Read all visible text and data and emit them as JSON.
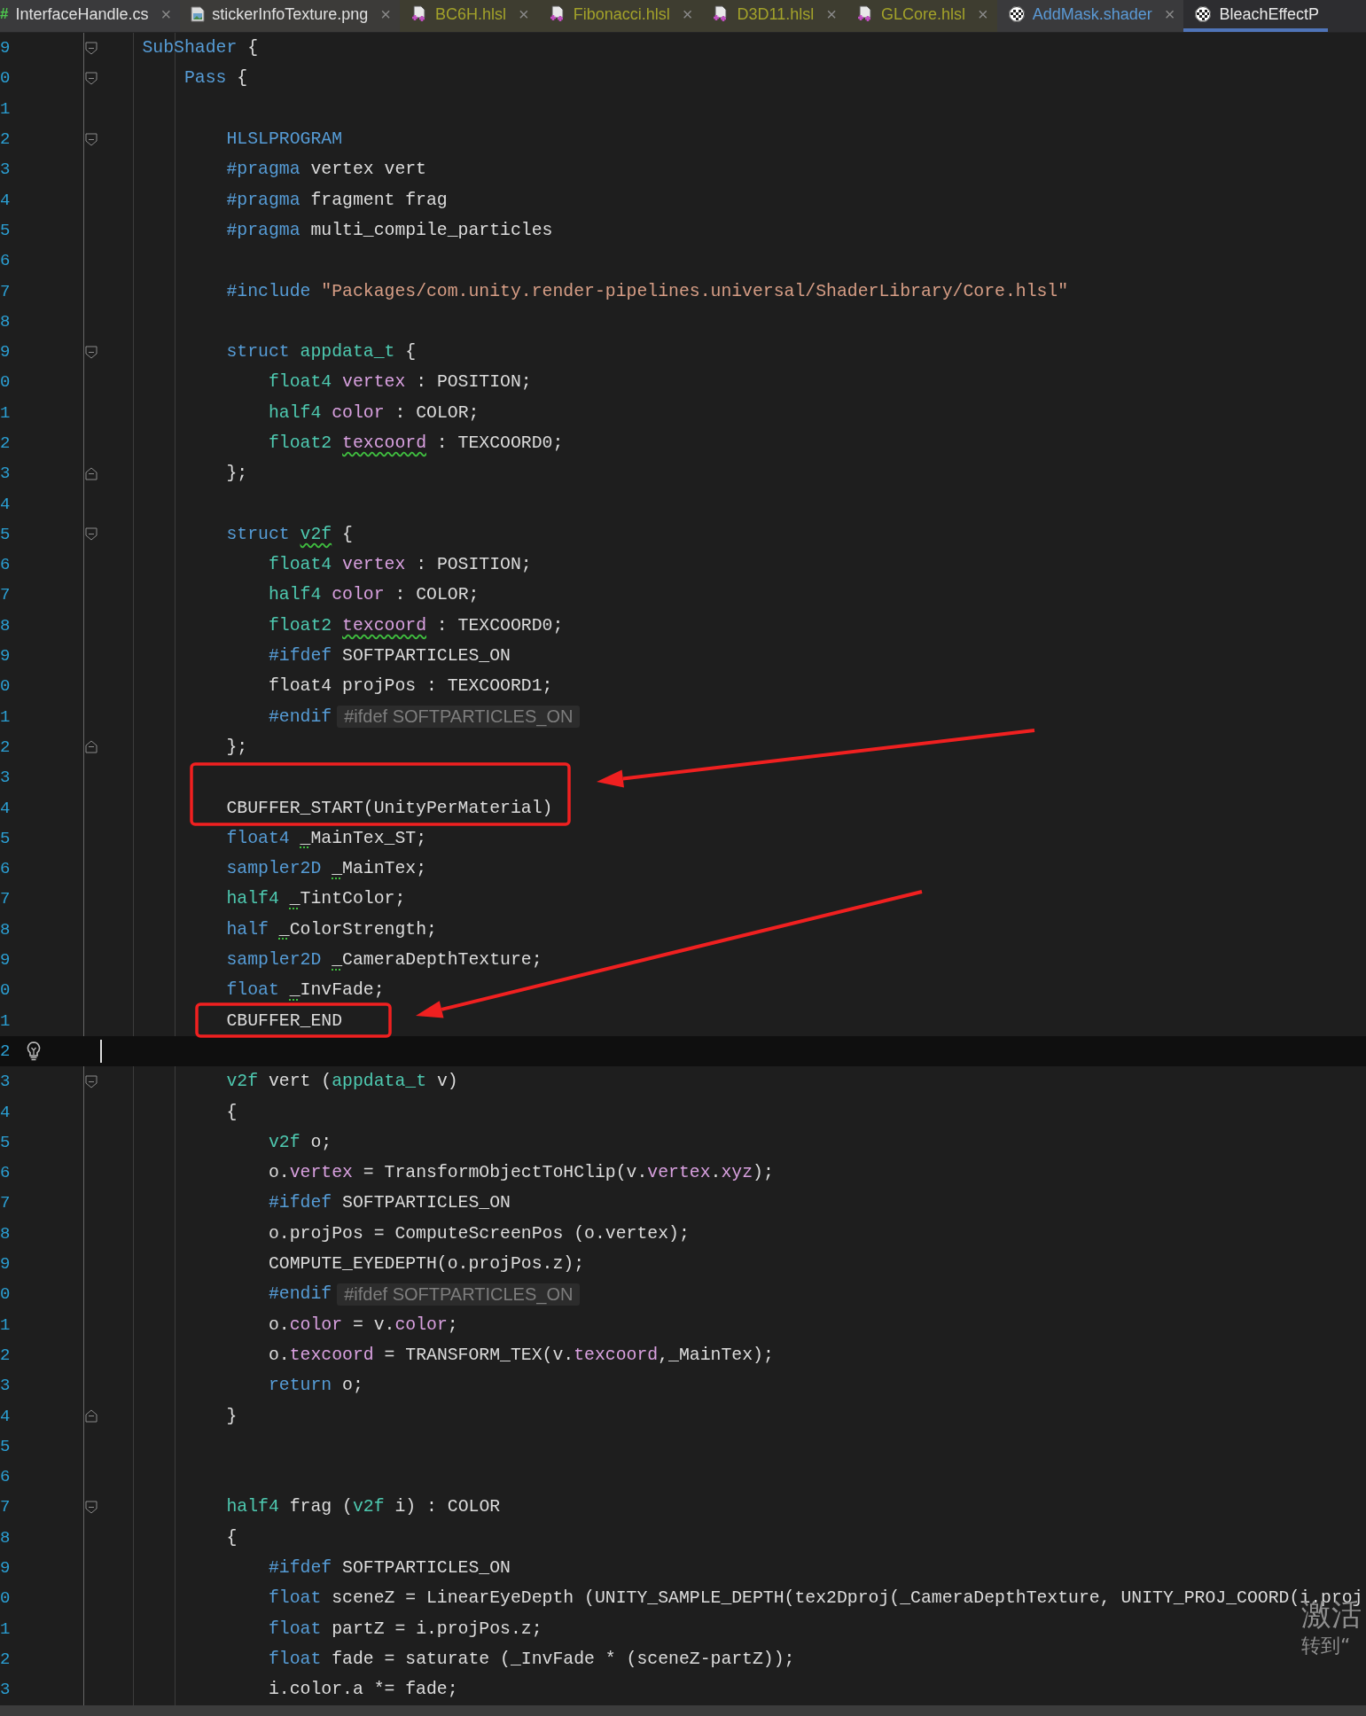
{
  "tabs": [
    {
      "glyph": "#",
      "label": "InterfaceHandle.cs",
      "kind": "cs",
      "close": "×",
      "selected": false
    },
    {
      "label": "stickerInfoTexture.png",
      "kind": "image",
      "close": "×",
      "selected": false
    },
    {
      "label": "BC6H.hlsl",
      "kind": "hlsl",
      "close": "×",
      "selected": false
    },
    {
      "label": "Fibonacci.hlsl",
      "kind": "hlsl",
      "close": "×",
      "selected": false
    },
    {
      "label": "D3D11.hlsl",
      "kind": "hlsl",
      "close": "×",
      "selected": false
    },
    {
      "label": "GLCore.hlsl",
      "kind": "hlsl",
      "close": "×",
      "selected": false
    },
    {
      "label": "AddMask.shader",
      "kind": "shader",
      "close": "×",
      "selected": false
    },
    {
      "label": "BleachEffectP",
      "kind": "shader",
      "selected": true
    }
  ],
  "lines": [
    {
      "number": "9",
      "block_start": true,
      "code": [
        {
          "kind": "kw",
          "text": "    SubShader"
        },
        {
          "kind": "plain",
          "text": " {"
        }
      ]
    },
    {
      "number": "0",
      "block_start": true,
      "code": [
        {
          "kind": "kw",
          "text": "        Pass"
        },
        {
          "kind": "plain",
          "text": " {"
        }
      ]
    },
    {
      "number": "1"
    },
    {
      "number": "2",
      "block_start": true,
      "code": [
        {
          "kind": "kw",
          "text": "            HLSLPROGRAM"
        }
      ]
    },
    {
      "number": "3",
      "code": [
        {
          "kind": "kw",
          "text": "            #pragma"
        },
        {
          "kind": "plain",
          "text": " vertex vert"
        }
      ]
    },
    {
      "number": "4",
      "code": [
        {
          "kind": "kw",
          "text": "            #pragma"
        },
        {
          "kind": "plain",
          "text": " fragment frag"
        }
      ]
    },
    {
      "number": "5",
      "code": [
        {
          "kind": "kw",
          "text": "            #pragma"
        },
        {
          "kind": "plain",
          "text": " multi_compile_particles"
        }
      ]
    },
    {
      "number": "6"
    },
    {
      "number": "7",
      "code": [
        {
          "kind": "kw",
          "text": "            #include"
        },
        {
          "kind": "str",
          "text": " \"Packages/com.unity.render-pipelines.universal/ShaderLibrary/Core.hlsl\""
        }
      ]
    },
    {
      "number": "8"
    },
    {
      "number": "9",
      "block_start": true,
      "code": [
        {
          "kind": "kw",
          "text": "            struct"
        },
        {
          "kind": "type",
          "text": " appdata_t"
        },
        {
          "kind": "plain",
          "text": " {"
        }
      ]
    },
    {
      "number": "0",
      "code": [
        {
          "kind": "type",
          "text": "                float4"
        },
        {
          "kind": "field",
          "text": " vertex"
        },
        {
          "kind": "plain",
          "text": " : POSITION;"
        }
      ]
    },
    {
      "number": "1",
      "code": [
        {
          "kind": "type",
          "text": "                half4"
        },
        {
          "kind": "field",
          "text": " color"
        },
        {
          "kind": "plain",
          "text": " : COLOR;"
        }
      ]
    },
    {
      "number": "2",
      "code": [
        {
          "kind": "type",
          "text": "                float2 "
        },
        {
          "kind": "fieldwarn",
          "text": "texcoord"
        },
        {
          "kind": "plain",
          "text": " : TEXCOORD0;"
        }
      ]
    },
    {
      "number": "3",
      "block_end": true,
      "code": [
        {
          "kind": "plain",
          "text": "            };"
        }
      ]
    },
    {
      "number": "4"
    },
    {
      "number": "5",
      "block_start": true,
      "code": [
        {
          "kind": "kw",
          "text": "            struct "
        },
        {
          "kind": "typewarn",
          "text": "v2f"
        },
        {
          "kind": "plain",
          "text": " {"
        }
      ]
    },
    {
      "number": "6",
      "code": [
        {
          "kind": "type",
          "text": "                float4"
        },
        {
          "kind": "field",
          "text": " vertex"
        },
        {
          "kind": "plain",
          "text": " : POSITION;"
        }
      ]
    },
    {
      "number": "7",
      "code": [
        {
          "kind": "type",
          "text": "                half4"
        },
        {
          "kind": "field",
          "text": " color"
        },
        {
          "kind": "plain",
          "text": " : COLOR;"
        }
      ]
    },
    {
      "number": "8",
      "code": [
        {
          "kind": "type",
          "text": "                float2 "
        },
        {
          "kind": "fieldwarn",
          "text": "texcoord"
        },
        {
          "kind": "plain",
          "text": " : TEXCOORD0;"
        }
      ]
    },
    {
      "number": "9",
      "code": [
        {
          "kind": "kw",
          "text": "                #ifdef"
        },
        {
          "kind": "plain",
          "text": " SOFTPARTICLES_ON"
        }
      ]
    },
    {
      "number": "0",
      "code": [
        {
          "kind": "plain",
          "text": "                float4 projPos : TEXCOORD1;"
        }
      ]
    },
    {
      "number": "1",
      "code": [
        {
          "kind": "kw",
          "text": "                #endif"
        }
      ],
      "hint": "#ifdef SOFTPARTICLES_ON"
    },
    {
      "number": "2",
      "block_end": true,
      "code": [
        {
          "kind": "plain",
          "text": "            };"
        }
      ]
    },
    {
      "number": "3"
    },
    {
      "number": "4",
      "code": [
        {
          "kind": "plain",
          "text": "            CBUFFER_START(UnityPerMaterial)"
        }
      ]
    },
    {
      "number": "5",
      "code": [
        {
          "kind": "kw",
          "text": "            float4 "
        },
        {
          "kind": "plainwarn",
          "text": "_"
        },
        {
          "kind": "plain",
          "text": "MainTex_ST;"
        }
      ]
    },
    {
      "number": "6",
      "code": [
        {
          "kind": "kw",
          "text": "            sampler2D "
        },
        {
          "kind": "plainwarn",
          "text": "_"
        },
        {
          "kind": "plain",
          "text": "MainTex;"
        }
      ]
    },
    {
      "number": "7",
      "code": [
        {
          "kind": "type",
          "text": "            half4 "
        },
        {
          "kind": "plainwarn",
          "text": "_"
        },
        {
          "kind": "plain",
          "text": "TintColor;"
        }
      ]
    },
    {
      "number": "8",
      "code": [
        {
          "kind": "kw",
          "text": "            half "
        },
        {
          "kind": "plainwarn",
          "text": "_"
        },
        {
          "kind": "plain",
          "text": "ColorStrength;"
        }
      ]
    },
    {
      "number": "9",
      "code": [
        {
          "kind": "kw",
          "text": "            sampler2D "
        },
        {
          "kind": "plainwarn",
          "text": "_"
        },
        {
          "kind": "plain",
          "text": "CameraDepthTexture;"
        }
      ]
    },
    {
      "number": "0",
      "code": [
        {
          "kind": "kw",
          "text": "            float "
        },
        {
          "kind": "plainwarn",
          "text": "_"
        },
        {
          "kind": "plain",
          "text": "InvFade;"
        }
      ]
    },
    {
      "number": "1",
      "code": [
        {
          "kind": "plain",
          "text": "            CBUFFER_END"
        }
      ]
    },
    {
      "number": "2",
      "current": true,
      "bulb": true,
      "cursor": true
    },
    {
      "number": "3",
      "block_start": true,
      "code": [
        {
          "kind": "type",
          "text": "            v2f"
        },
        {
          "kind": "plain",
          "text": " vert ("
        },
        {
          "kind": "type",
          "text": "appdata_t"
        },
        {
          "kind": "plain",
          "text": " v)"
        }
      ]
    },
    {
      "number": "4",
      "code": [
        {
          "kind": "plain",
          "text": "            {"
        }
      ]
    },
    {
      "number": "5",
      "code": [
        {
          "kind": "type",
          "text": "                v2f"
        },
        {
          "kind": "plain",
          "text": " o;"
        }
      ]
    },
    {
      "number": "6",
      "code": [
        {
          "kind": "plain",
          "text": "                o."
        },
        {
          "kind": "field",
          "text": "vertex"
        },
        {
          "kind": "plain",
          "text": " = TransformObjectToHClip(v."
        },
        {
          "kind": "field",
          "text": "vertex"
        },
        {
          "kind": "plain",
          "text": "."
        },
        {
          "kind": "field",
          "text": "xyz"
        },
        {
          "kind": "plain",
          "text": ");"
        }
      ]
    },
    {
      "number": "7",
      "code": [
        {
          "kind": "kw",
          "text": "                #ifdef"
        },
        {
          "kind": "plain",
          "text": " SOFTPARTICLES_ON"
        }
      ]
    },
    {
      "number": "8",
      "code": [
        {
          "kind": "plain",
          "text": "                o.projPos = ComputeScreenPos (o.vertex);"
        }
      ]
    },
    {
      "number": "9",
      "code": [
        {
          "kind": "plain",
          "text": "                COMPUTE_EYEDEPTH(o.projPos.z);"
        }
      ]
    },
    {
      "number": "0",
      "code": [
        {
          "kind": "kw",
          "text": "                #endif"
        }
      ],
      "hint": "#ifdef SOFTPARTICLES_ON"
    },
    {
      "number": "1",
      "code": [
        {
          "kind": "plain",
          "text": "                o."
        },
        {
          "kind": "field",
          "text": "color"
        },
        {
          "kind": "plain",
          "text": " = v."
        },
        {
          "kind": "field",
          "text": "color"
        },
        {
          "kind": "plain",
          "text": ";"
        }
      ]
    },
    {
      "number": "2",
      "code": [
        {
          "kind": "plain",
          "text": "                o."
        },
        {
          "kind": "field",
          "text": "texcoord"
        },
        {
          "kind": "plain",
          "text": " = TRANSFORM_TEX(v."
        },
        {
          "kind": "field",
          "text": "texcoord"
        },
        {
          "kind": "plain",
          "text": ",_MainTex);"
        }
      ]
    },
    {
      "number": "3",
      "code": [
        {
          "kind": "kw",
          "text": "                return"
        },
        {
          "kind": "plain",
          "text": " o;"
        }
      ]
    },
    {
      "number": "4",
      "block_end": true,
      "code": [
        {
          "kind": "plain",
          "text": "            }"
        }
      ]
    },
    {
      "number": "5"
    },
    {
      "number": "6"
    },
    {
      "number": "7",
      "block_start": true,
      "code": [
        {
          "kind": "type",
          "text": "            half4"
        },
        {
          "kind": "plain",
          "text": " frag ("
        },
        {
          "kind": "type",
          "text": "v2f"
        },
        {
          "kind": "plain",
          "text": " i) : COLOR"
        }
      ]
    },
    {
      "number": "8",
      "code": [
        {
          "kind": "plain",
          "text": "            {"
        }
      ]
    },
    {
      "number": "9",
      "code": [
        {
          "kind": "kw",
          "text": "                #ifdef"
        },
        {
          "kind": "plain",
          "text": " SOFTPARTICLES_ON"
        }
      ]
    },
    {
      "number": "0",
      "code": [
        {
          "kind": "kw",
          "text": "                float"
        },
        {
          "kind": "plain",
          "text": " sceneZ = LinearEyeDepth (UNITY_SAMPLE_DEPTH(tex2Dproj(_CameraDepthTexture, UNITY_PROJ_COORD(i.proj"
        }
      ]
    },
    {
      "number": "1",
      "code": [
        {
          "kind": "kw",
          "text": "                float"
        },
        {
          "kind": "plain",
          "text": " partZ = i.projPos.z;"
        }
      ]
    },
    {
      "number": "2",
      "code": [
        {
          "kind": "kw",
          "text": "                float"
        },
        {
          "kind": "plain",
          "text": " fade = saturate (_InvFade * (sceneZ-partZ));"
        }
      ]
    },
    {
      "number": "3",
      "code": [
        {
          "kind": "plain",
          "text": "                i.color.a *= fade;"
        }
      ]
    }
  ],
  "annotations": [
    {
      "kind": "box"
    },
    {
      "kind": "arrow"
    },
    {
      "kind": "box"
    },
    {
      "kind": "arrow"
    }
  ],
  "activation": {
    "title": "激活",
    "subtitle": "转到“"
  }
}
